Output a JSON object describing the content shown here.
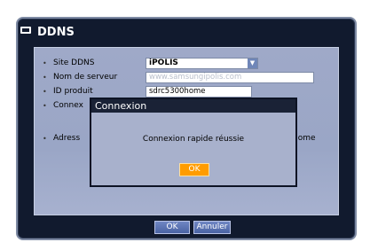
{
  "window": {
    "title": "DDNS",
    "icon": "ddns-icon"
  },
  "form": {
    "site_label": "Site DDNS",
    "site_value": "iPOLIS",
    "server_label": "Nom de serveur",
    "server_value": "www.samsungipolis.com",
    "id_label": "ID produit",
    "id_value": "sdrc5300home",
    "connect_label": "Connex",
    "address_label": "Adress",
    "address_tail": "home"
  },
  "dialog": {
    "title": "Connexion",
    "message": "Connexion rapide réussie",
    "ok_label": "OK"
  },
  "footer": {
    "ok_label": "OK",
    "cancel_label": "Annuler"
  },
  "colors": {
    "accent": "#ff9c00",
    "window_bg": "#111a2e",
    "panel_bg": "#9fa9c8"
  }
}
